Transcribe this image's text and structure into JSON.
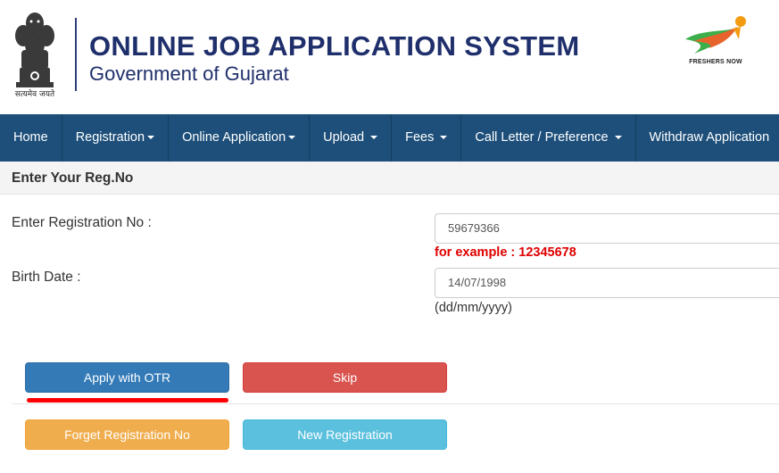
{
  "header": {
    "emblem_caption": "सत्यमेव जयते",
    "title": "ONLINE JOB APPLICATION SYSTEM",
    "subtitle": "Government of Gujarat",
    "logo_caption": "FRESHERS NOW"
  },
  "nav": {
    "items": [
      {
        "label": "Home",
        "dropdown": false
      },
      {
        "label": "Registration",
        "dropdown": true
      },
      {
        "label": "Online Application",
        "dropdown": true
      },
      {
        "label": "Upload",
        "dropdown": true
      },
      {
        "label": "Fees",
        "dropdown": true
      },
      {
        "label": "Call Letter / Preference",
        "dropdown": true
      },
      {
        "label": "Withdraw Application",
        "dropdown": false
      }
    ]
  },
  "form": {
    "heading": "Enter Your Reg.No",
    "reg_label": "Enter Registration No :",
    "reg_value": "59679366",
    "reg_example": "for example : 12345678",
    "birth_label": "Birth Date :",
    "birth_value": "14/07/1998",
    "birth_hint": "(dd/mm/yyyy)"
  },
  "buttons": {
    "apply_otr": "Apply with OTR",
    "skip": "Skip",
    "forget_reg": "Forget Registration No",
    "new_reg": "New Registration"
  },
  "colors": {
    "navbar": "#1d4f7a",
    "title": "#1f2f6b",
    "primary": "#337ab7",
    "danger": "#d9534f",
    "warning": "#f0ad4e",
    "info": "#5bc0de",
    "highlight": "#ff0000"
  }
}
